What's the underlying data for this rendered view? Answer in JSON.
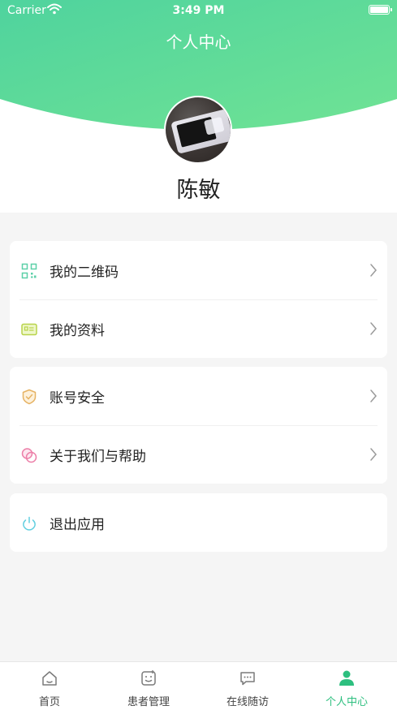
{
  "status_bar": {
    "carrier": "Carrier",
    "time": "3:49 PM"
  },
  "header": {
    "title": "个人中心"
  },
  "profile": {
    "name": "陈敏"
  },
  "menu_group_1": [
    {
      "label": "我的二维码",
      "icon": "qr-code-icon"
    },
    {
      "label": "我的资料",
      "icon": "id-card-icon"
    }
  ],
  "menu_group_2": [
    {
      "label": "账号安全",
      "icon": "shield-icon"
    },
    {
      "label": "关于我们与帮助",
      "icon": "help-circles-icon"
    }
  ],
  "menu_group_3": [
    {
      "label": "退出应用",
      "icon": "power-icon"
    }
  ],
  "tab_bar": {
    "items": [
      {
        "label": "首页",
        "icon": "home-icon"
      },
      {
        "label": "患者管理",
        "icon": "patient-icon"
      },
      {
        "label": "在线随访",
        "icon": "chat-icon"
      },
      {
        "label": "个人中心",
        "icon": "person-icon",
        "active": true
      }
    ]
  },
  "colors": {
    "accent": "#2dbf7f",
    "header_gradient_start": "#5fd89a",
    "header_gradient_end": "#6ee7a6"
  }
}
